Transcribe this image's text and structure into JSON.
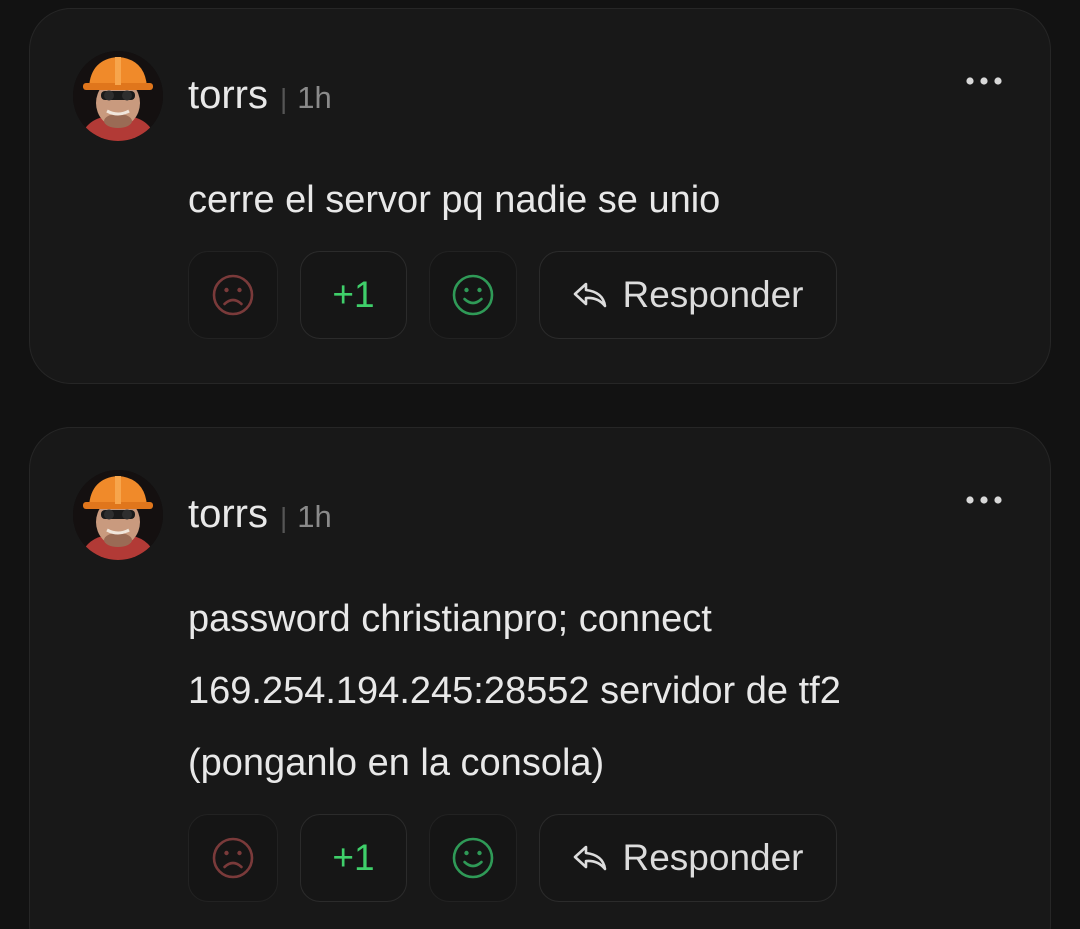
{
  "posts": [
    {
      "author": "torrs",
      "separator": "|",
      "time": "1h",
      "body_lines": [
        "cerre el servor pq nadie se unio"
      ],
      "score": "+1",
      "reply_label": "Responder",
      "more_icon": "ellipsis-icon",
      "avatar_icon": "engineer-avatar"
    },
    {
      "author": "torrs",
      "separator": "|",
      "time": "1h",
      "body_lines": [
        "password christianpro; connect",
        "169.254.194.245:28552 servidor de tf2",
        "(ponganlo en la consola)"
      ],
      "score": "+1",
      "reply_label": "Responder",
      "more_icon": "ellipsis-icon",
      "avatar_icon": "engineer-avatar"
    }
  ],
  "colors": {
    "background": "#121212",
    "card": "#181818",
    "score_green": "#3fcf6a",
    "happy_green": "#2f9a57",
    "sad_red": "#7a3a3a"
  }
}
